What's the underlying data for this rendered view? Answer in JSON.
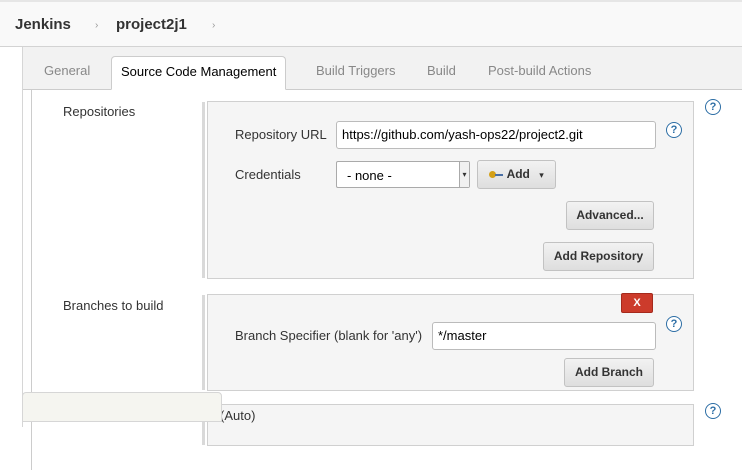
{
  "breadcrumb": {
    "items": [
      "Jenkins",
      "project2j1"
    ],
    "separator": "›"
  },
  "tabs": [
    {
      "label": "General",
      "active": false
    },
    {
      "label": "Source Code Management",
      "active": true
    },
    {
      "label": "Build Triggers",
      "active": false
    },
    {
      "label": "Build",
      "active": false
    },
    {
      "label": "Post-build Actions",
      "active": false
    }
  ],
  "scm": {
    "repositories_label": "Repositories",
    "repository_url_label": "Repository URL",
    "repository_url_value": "https://github.com/yash-ops22/project2.git",
    "credentials_label": "Credentials",
    "credentials_selected": "- none -",
    "add_label": "Add",
    "advanced_label": "Advanced...",
    "add_repository_label": "Add Repository",
    "branches_label": "Branches to build",
    "delete_label": "X",
    "branch_specifier_label": "Branch Specifier (blank for 'any')",
    "branch_specifier_value": "*/master",
    "add_branch_label": "Add Branch",
    "next_row_partial": "(Auto)"
  },
  "icons": {
    "help": "?",
    "dropdown": "▾"
  },
  "colors": {
    "help_blue": "#2d6ea5",
    "delete_red": "#cc3b2b"
  }
}
